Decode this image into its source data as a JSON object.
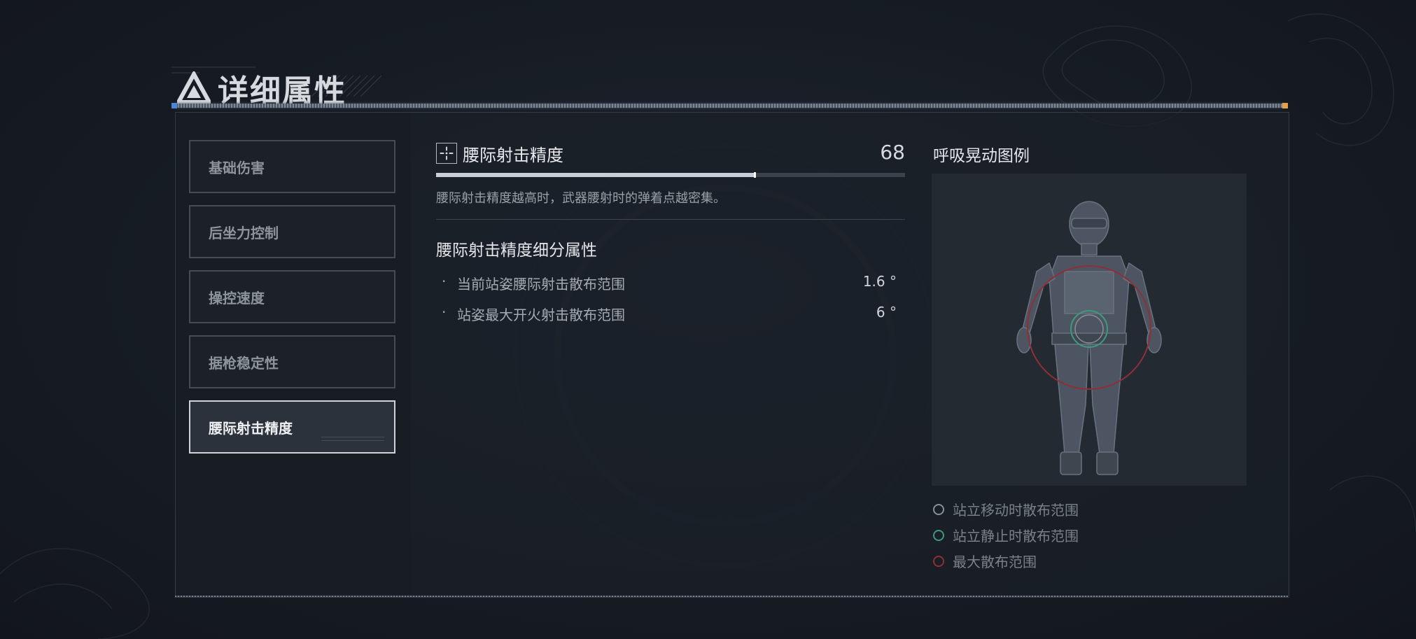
{
  "header": {
    "title": "详细属性"
  },
  "sidebar": {
    "items": [
      {
        "label": "基础伤害",
        "active": false
      },
      {
        "label": "后坐力控制",
        "active": false
      },
      {
        "label": "操控速度",
        "active": false
      },
      {
        "label": "据枪稳定性",
        "active": false
      },
      {
        "label": "腰际射击精度",
        "active": true
      }
    ]
  },
  "stat": {
    "name": "腰际射击精度",
    "value": "68",
    "bar_fraction": 0.68,
    "description": "腰际射击精度越高时，武器腰射时的弹着点越密集。",
    "sub_title": "腰际射击精度细分属性",
    "sub_items": [
      {
        "bullet": "·",
        "label": "当前站姿腰际射击散布范围",
        "value": "1.6 °"
      },
      {
        "bullet": "·",
        "label": "站姿最大开火射击散布范围",
        "value": "6 °"
      }
    ]
  },
  "legend": {
    "title": "呼吸晃动图例",
    "items": [
      {
        "label": "站立移动时散布范围",
        "color": "#8a8f96"
      },
      {
        "label": "站立静止时散布范围",
        "color": "#3f9a7c"
      },
      {
        "label": "最大散布范围",
        "color": "#8f2f36"
      }
    ]
  },
  "colors": {
    "accent_left": "#4a86d8",
    "accent_right": "#e2a24a",
    "panel_border": "#353c46"
  }
}
